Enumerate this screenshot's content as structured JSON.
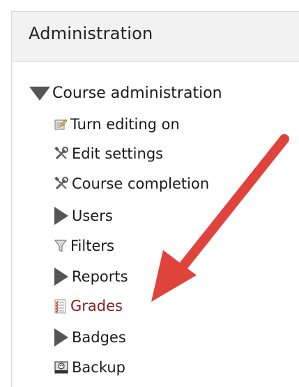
{
  "block": {
    "title": "Administration"
  },
  "tree": {
    "course_admin_label": "Course administration",
    "items": [
      {
        "label": "Turn editing on",
        "icon": "edit-document-icon"
      },
      {
        "label": "Edit settings",
        "icon": "tools-icon"
      },
      {
        "label": "Course completion",
        "icon": "tools-icon"
      },
      {
        "label": "Users",
        "icon": "expand-triangle-icon"
      },
      {
        "label": "Filters",
        "icon": "funnel-icon"
      },
      {
        "label": "Reports",
        "icon": "expand-triangle-icon"
      },
      {
        "label": "Grades",
        "icon": "grades-icon"
      },
      {
        "label": "Badges",
        "icon": "expand-triangle-icon"
      },
      {
        "label": "Backup",
        "icon": "backup-icon"
      }
    ]
  },
  "annotation": {
    "arrow_color": "#e0433b"
  }
}
